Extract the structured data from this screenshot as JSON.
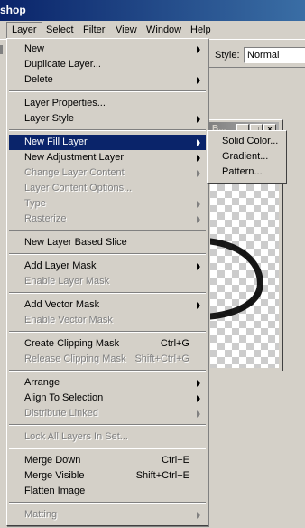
{
  "app": {
    "title_fragment": "shop"
  },
  "menubar": [
    {
      "id": "layer",
      "label": "Layer",
      "active": true
    },
    {
      "id": "select",
      "label": "Select"
    },
    {
      "id": "filter",
      "label": "Filter"
    },
    {
      "id": "view",
      "label": "View"
    },
    {
      "id": "window",
      "label": "Window"
    },
    {
      "id": "help",
      "label": "Help"
    }
  ],
  "options": {
    "style_label": "Style:",
    "style_value": "Normal"
  },
  "doc_window": {
    "title": "B..."
  },
  "layer_menu": [
    {
      "label": "New",
      "submenu": true
    },
    {
      "label": "Duplicate Layer..."
    },
    {
      "label": "Delete",
      "submenu": true
    },
    {
      "separator": true
    },
    {
      "label": "Layer Properties..."
    },
    {
      "label": "Layer Style",
      "submenu": true
    },
    {
      "separator": true
    },
    {
      "label": "New Fill Layer",
      "submenu": true,
      "highlighted": true
    },
    {
      "label": "New Adjustment Layer",
      "submenu": true
    },
    {
      "label": "Change Layer Content",
      "submenu": true,
      "disabled": true
    },
    {
      "label": "Layer Content Options...",
      "disabled": true
    },
    {
      "label": "Type",
      "submenu": true,
      "disabled": true
    },
    {
      "label": "Rasterize",
      "submenu": true,
      "disabled": true
    },
    {
      "separator": true
    },
    {
      "label": "New Layer Based Slice"
    },
    {
      "separator": true
    },
    {
      "label": "Add Layer Mask",
      "submenu": true
    },
    {
      "label": "Enable Layer Mask",
      "disabled": true
    },
    {
      "separator": true
    },
    {
      "label": "Add Vector Mask",
      "submenu": true
    },
    {
      "label": "Enable Vector Mask",
      "disabled": true
    },
    {
      "separator": true
    },
    {
      "label": "Create Clipping Mask",
      "shortcut": "Ctrl+G"
    },
    {
      "label": "Release Clipping Mask",
      "shortcut": "Shift+Ctrl+G",
      "disabled": true
    },
    {
      "separator": true
    },
    {
      "label": "Arrange",
      "submenu": true
    },
    {
      "label": "Align To Selection",
      "submenu": true
    },
    {
      "label": "Distribute Linked",
      "submenu": true,
      "disabled": true
    },
    {
      "separator": true
    },
    {
      "label": "Lock All Layers In Set...",
      "disabled": true
    },
    {
      "separator": true
    },
    {
      "label": "Merge Down",
      "shortcut": "Ctrl+E"
    },
    {
      "label": "Merge Visible",
      "shortcut": "Shift+Ctrl+E"
    },
    {
      "label": "Flatten Image"
    },
    {
      "separator": true
    },
    {
      "label": "Matting",
      "submenu": true,
      "disabled": true
    }
  ],
  "fill_submenu": [
    {
      "label": "Solid Color..."
    },
    {
      "label": "Gradient..."
    },
    {
      "label": "Pattern..."
    }
  ]
}
